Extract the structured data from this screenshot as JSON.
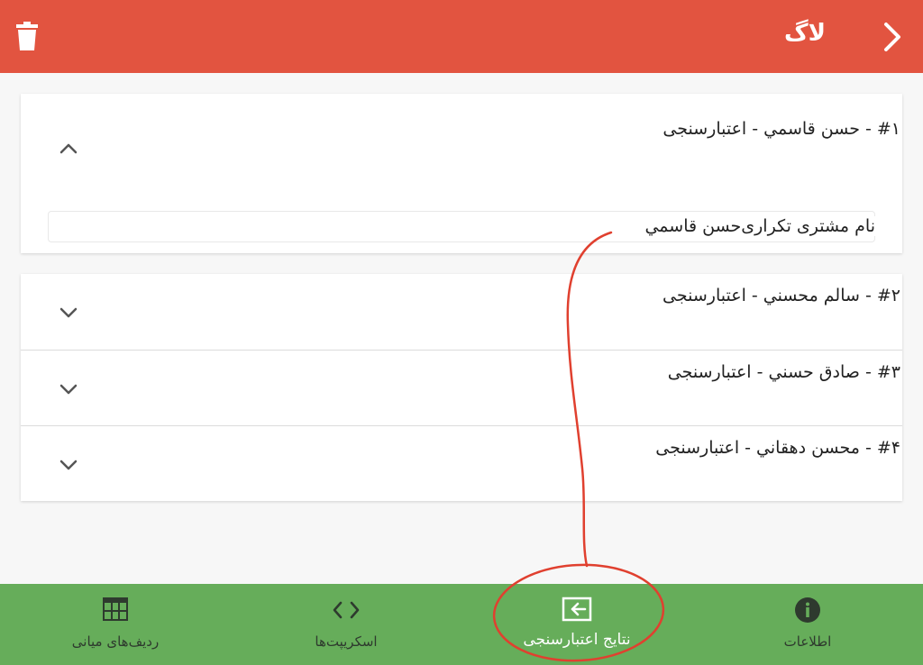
{
  "header": {
    "title": "لاگ",
    "back_icon": "chevron-right-icon",
    "delete_icon": "trash-icon",
    "background": "#e25440"
  },
  "log_items": [
    {
      "title": "#۱ - حسن قاسمي - اعتبارسنجی",
      "expanded": true,
      "detail": "نام مشتری تکراری‌حسن قاسمي"
    },
    {
      "title": "#۲ - سالم محسني - اعتبارسنجی",
      "expanded": false
    },
    {
      "title": "#۳ - صادق حسني - اعتبارسنجی",
      "expanded": false
    },
    {
      "title": "#۴ - محسن دهقاني - اعتبارسنجی",
      "expanded": false
    }
  ],
  "bottom_nav": {
    "background": "#66ad5a",
    "tabs": [
      {
        "label": "اطلاعات",
        "icon": "info-icon"
      },
      {
        "label": "نتایج اعتبارسنجی",
        "icon": "login-icon",
        "active": true
      },
      {
        "label": "اسکریپت‌ها",
        "icon": "code-icon"
      },
      {
        "label": "ردیف‌های میانی",
        "icon": "table-icon"
      }
    ]
  },
  "annotation": {
    "color": "#e0402f"
  }
}
